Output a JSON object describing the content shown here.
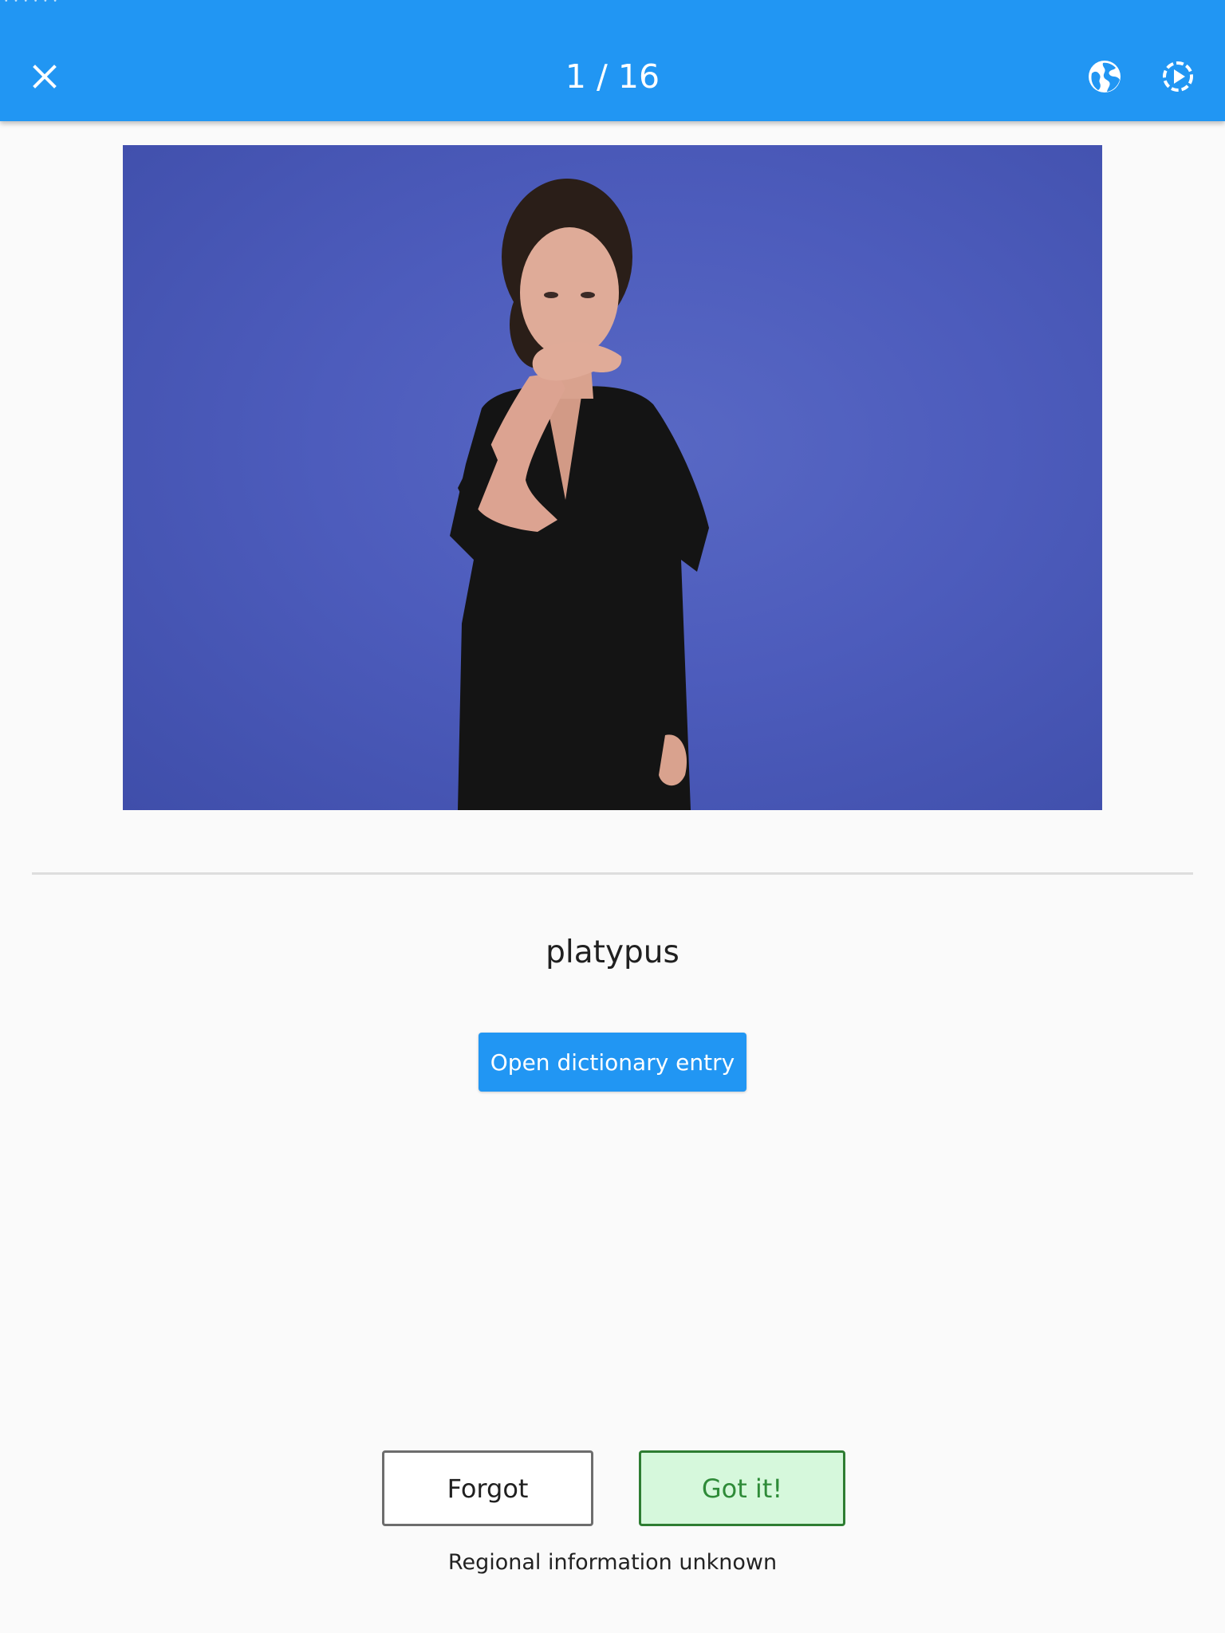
{
  "app_bar": {
    "title": "1 / 16",
    "color": "#2196f3",
    "icons": {
      "close": "close-icon",
      "globe": "globe-icon",
      "autoplay": "autoplay-icon"
    }
  },
  "video": {
    "background_color": "#4d5cbc"
  },
  "card": {
    "word": "platypus",
    "dictionary_button_label": "Open dictionary entry"
  },
  "actions": {
    "forgot_label": "Forgot",
    "got_it_label": "Got it!",
    "got_it_color": "#2e8b38",
    "got_it_background": "#d6f8dc"
  },
  "regional_info": "Regional information unknown"
}
